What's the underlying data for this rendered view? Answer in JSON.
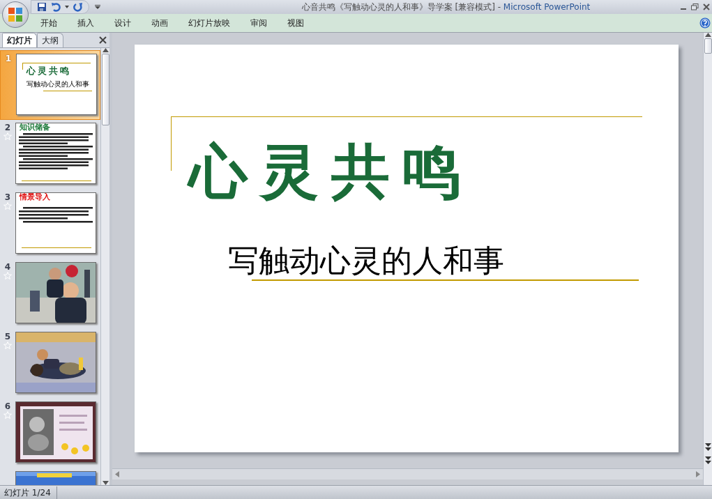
{
  "window": {
    "title_document": "心音共鸣《写触动心灵的人和事》导学案 [兼容模式]",
    "title_separator": "-",
    "title_app": "Microsoft PowerPoint"
  },
  "ribbon_tabs": [
    {
      "label": "开始"
    },
    {
      "label": "插入"
    },
    {
      "label": "设计"
    },
    {
      "label": "动画"
    },
    {
      "label": "幻灯片放映"
    },
    {
      "label": "审阅"
    },
    {
      "label": "视图"
    }
  ],
  "panel_tabs": [
    {
      "label": "幻灯片",
      "selected": true
    },
    {
      "label": "大纲",
      "selected": false
    }
  ],
  "thumbnails": [
    {
      "number": "1",
      "selected": true,
      "animated": false,
      "kind": "title",
      "title": "心灵共鸣",
      "subtitle": "写触动心灵的人和事"
    },
    {
      "number": "2",
      "selected": false,
      "animated": true,
      "kind": "text",
      "title": "知识储备",
      "color": "#1e7a3a"
    },
    {
      "number": "3",
      "selected": false,
      "animated": true,
      "kind": "text",
      "title": "情景导入",
      "color": "#e01010"
    },
    {
      "number": "4",
      "selected": false,
      "animated": true,
      "kind": "picture"
    },
    {
      "number": "5",
      "selected": false,
      "animated": true,
      "kind": "picture"
    },
    {
      "number": "6",
      "selected": false,
      "animated": true,
      "kind": "picture"
    },
    {
      "selected": false,
      "animated": false,
      "kind": "picture"
    }
  ],
  "slide": {
    "title": "心灵共鸣",
    "subtitle": "写触动心灵的人和事"
  },
  "status_bar": {
    "slide_counter": "幻灯片 1/24"
  }
}
